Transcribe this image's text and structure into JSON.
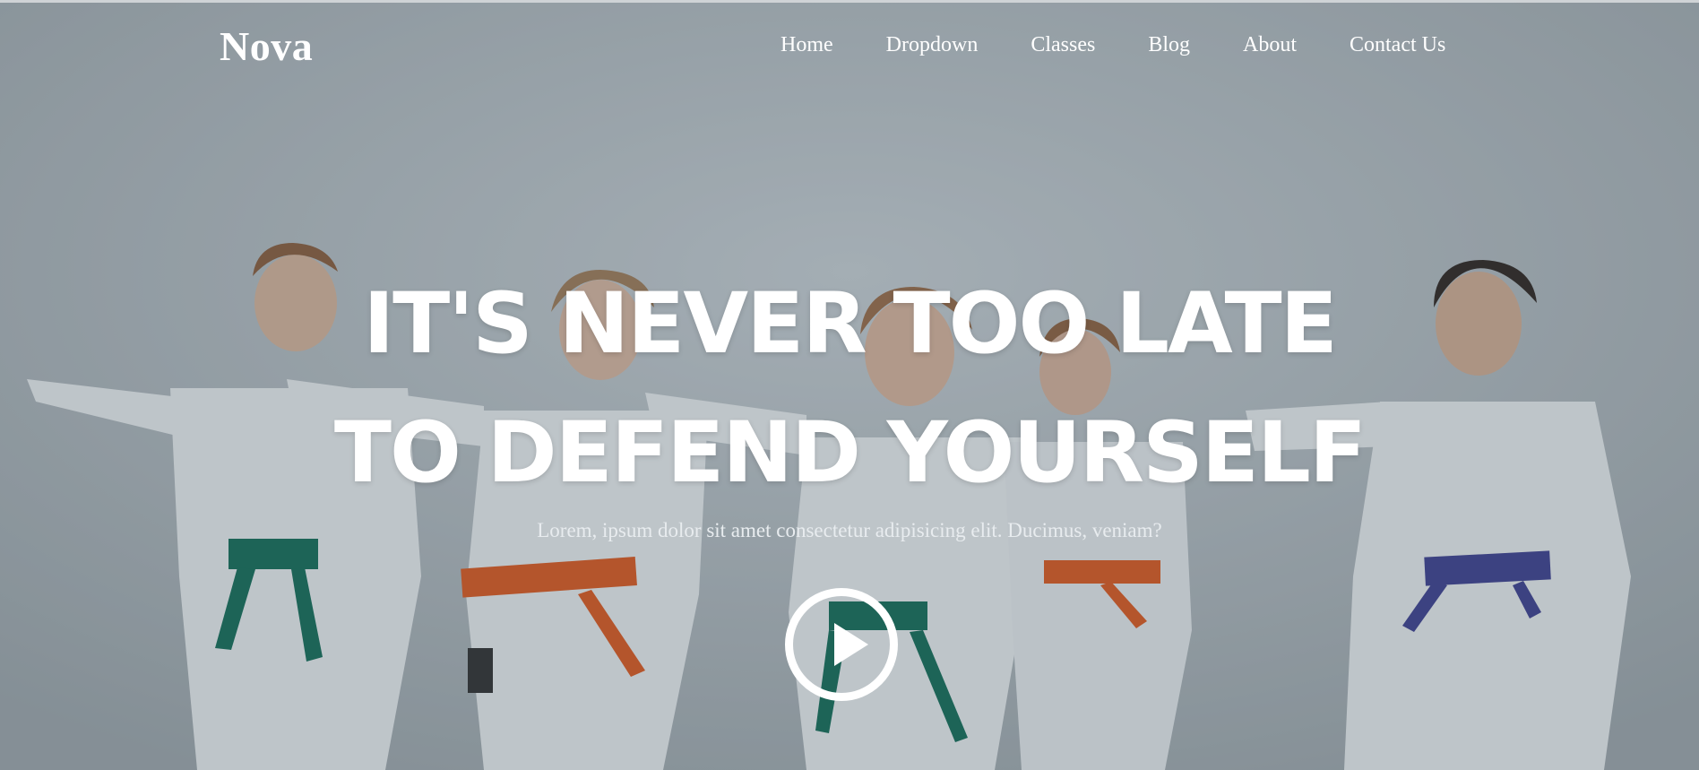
{
  "brand": {
    "name": "Nova"
  },
  "nav": {
    "items": [
      {
        "label": "Home"
      },
      {
        "label": "Dropdown"
      },
      {
        "label": "Classes"
      },
      {
        "label": "Blog"
      },
      {
        "label": "About"
      },
      {
        "label": "Contact Us"
      }
    ]
  },
  "hero": {
    "headline_line1": "IT'S NEVER TOO LATE",
    "headline_line2": "TO DEFEND YOURSELF",
    "subtitle": "Lorem, ipsum dolor sit amet consectetur adipisicing elit. Ducimus, veniam?",
    "play_icon": "play-icon"
  },
  "colors": {
    "text": "#ffffff",
    "overlay": "#46525c",
    "belt_green": "#0e6b55",
    "belt_orange": "#e0561a",
    "belt_blue": "#3a3c8f"
  }
}
